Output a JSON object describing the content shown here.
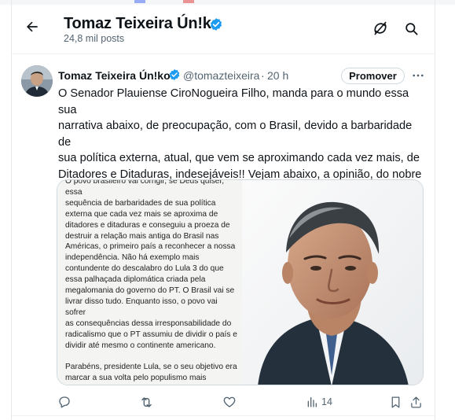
{
  "header": {
    "name": "Tomaz Teixeira Ún!ko",
    "posts_count": "24,8 mil posts"
  },
  "tweet": {
    "author_name": "Tomaz Teixeira Ún!ko",
    "handle": "@tomazteixeira",
    "separator": "·",
    "time": "20 h",
    "promote_label": "Promover",
    "text": "O Senador Plauiense CiroNogueira Filho, manda para o mundo essa sua\nnarrativa abaixo, de preocupação, com o Brasil,  devido a barbaridade de\nsua política externa, atual, que vem se aproximando cada vez mais, de\nDitadores e Ditaduras, indesejáveis!! Vejam abaixo, a opinião, do nobre\nSenador Piauiense, Presidente do Partido Progressista!! Acompanhem e se\ndeleitem, com o texto abaixo!!!",
    "media": {
      "document_text": "O povo brasileiro vai corrigir, se Deus quiser, essa\nsequência de barbaridades de sua política\nexterna que cada vez mais se aproxima de\nditadores e ditaduras e conseguiu a proeza de\ndestruir a relação mais antiga do Brasil nas\nAméricas, o primeiro país a reconhecer a nossa\nindependência. Não há exemplo mais\ncontundente do descalabro do Lula 3 do que\nessa palhaçada diplomática criada pela\nmegalomania do governo do PT. O Brasil vai se\nlivrar disso tudo. Enquanto isso, o povo vai sofrer\nas consequências dessa irresponsabilidade do\nradicalismo que o PT assumiu de dividir o país e\ndividir até mesmo o continente americano.\n\nParabéns, presidente Lula, se o seu objetivo era\nmarcar a sua volta pelo populismo mais\nrepugnantemente, o senhor verdadeiramente\nconseguiu. Deus proteja o povo brasileiro. Nós da\noposição nunca vamos desistir do Brasil."
    },
    "actions": {
      "reply_count": "",
      "repost_count": "",
      "like_count": "",
      "views_count": "14"
    }
  },
  "colors": {
    "verified": "#1d9bf0",
    "muted_text": "#536471",
    "border": "#cfd9de"
  }
}
